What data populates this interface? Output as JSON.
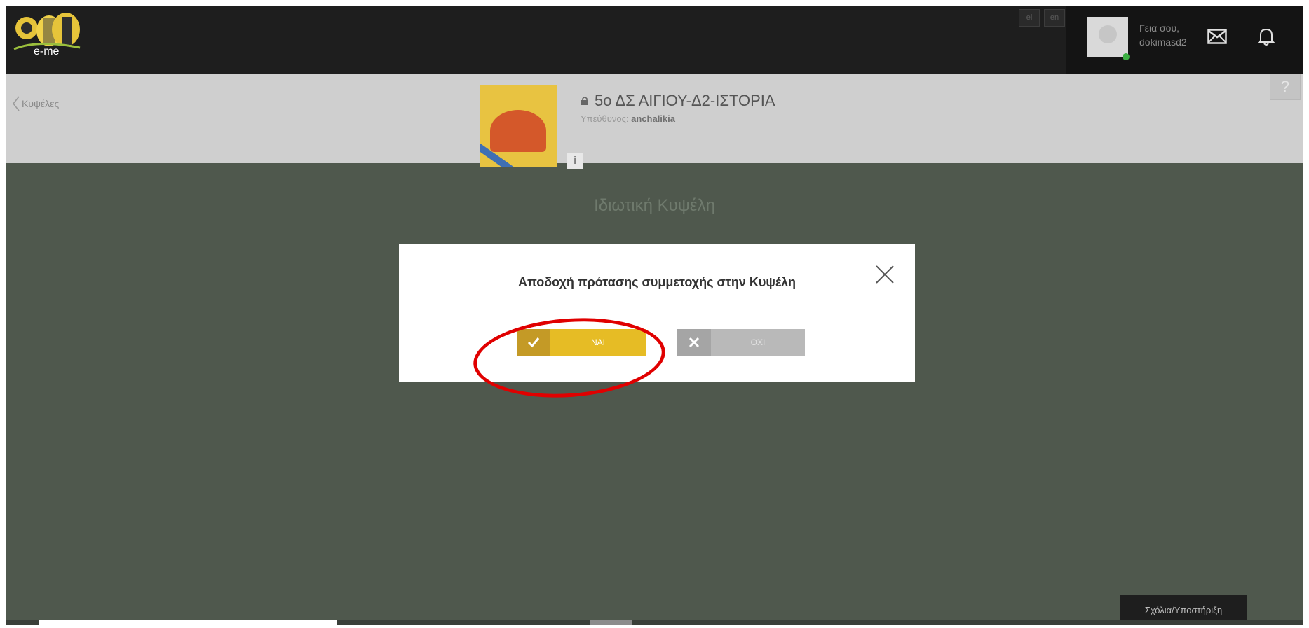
{
  "brand": {
    "logo_text": "e-me"
  },
  "header": {
    "lang_el": "el",
    "lang_en": "en",
    "greeting_line1": "Γεια σου,",
    "greeting_line2": "dokimasd2"
  },
  "hive": {
    "back_label": "Κυψέλες",
    "title": "5ο ΔΣ ΑΙΓΙΟΥ-Δ2-ΙΣΤΟΡΙΑ",
    "owner_prefix": "Υπεύθυνος:",
    "owner_name": "anchalikia",
    "info_label": "i",
    "help_label": "?",
    "private_label": "Ιδιωτική Κυψέλη"
  },
  "modal": {
    "title": "Αποδοχή πρότασης συμμετοχής στην Κυψέλη",
    "yes_label": "ΝΑΙ",
    "no_label": "ΟΧΙ"
  },
  "footer": {
    "feedback_label": "Σχόλια/Υποστήριξη"
  },
  "colors": {
    "topbar": "#1e1e1e",
    "overlay_bg": "#4f584d",
    "yes_button": "#e6bc25",
    "no_button": "#b9b9b9",
    "highlight": "#e00000"
  },
  "icons": [
    "logo-bee-icon",
    "lock-icon",
    "mail-icon",
    "bell-icon",
    "chevron-left-icon",
    "check-icon",
    "x-icon",
    "close-icon"
  ]
}
